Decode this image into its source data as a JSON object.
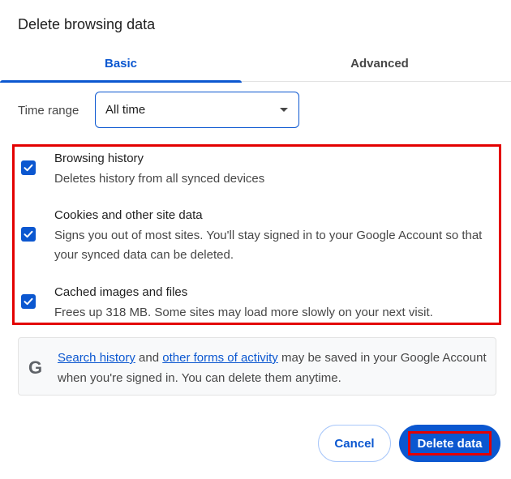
{
  "dialog": {
    "title": "Delete browsing data"
  },
  "tabs": [
    {
      "label": "Basic",
      "selected": true
    },
    {
      "label": "Advanced",
      "selected": false
    }
  ],
  "time_range": {
    "label": "Time range",
    "value": "All time"
  },
  "options": [
    {
      "title": "Browsing history",
      "description": "Deletes history from all synced devices",
      "checked": true
    },
    {
      "title": "Cookies and other site data",
      "description": "Signs you out of most sites. You'll stay signed in to your Google Account so that your synced data can be deleted.",
      "checked": true
    },
    {
      "title": "Cached images and files",
      "description": "Frees up 318 MB. Some sites may load more slowly on your next visit.",
      "checked": true
    }
  ],
  "info": {
    "icon": "google-g-icon",
    "link1": "Search history",
    "text1": " and ",
    "link2": "other forms of activity",
    "text2": " may be saved in your Google Account when you're signed in. You can delete them anytime."
  },
  "buttons": {
    "cancel": "Cancel",
    "delete": "Delete data"
  },
  "colors": {
    "accent": "#0b57d0",
    "highlight": "#e30000",
    "text": "#1f1f1f",
    "muted": "#474747"
  }
}
